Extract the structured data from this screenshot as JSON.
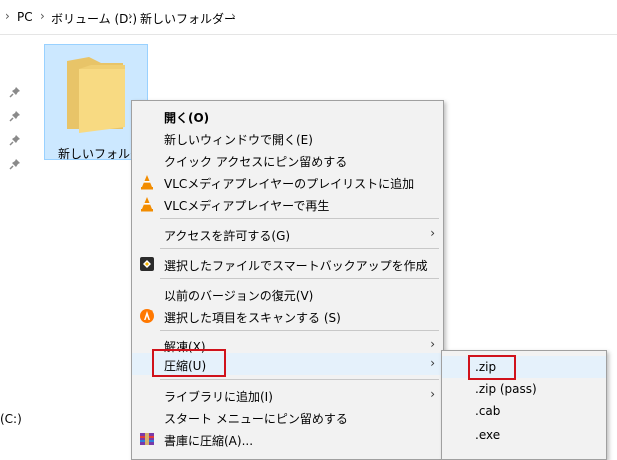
{
  "breadcrumb": {
    "items": [
      "PC",
      "ボリューム (D:)",
      "新しいフォルダー"
    ]
  },
  "navigation": {
    "drive_label": "(C:)"
  },
  "folder": {
    "name": "新しいフォルダー",
    "selected": true
  },
  "context_menu": {
    "items": [
      {
        "label": "開く(O)",
        "bold": true
      },
      {
        "label": "新しいウィンドウで開く(E)"
      },
      {
        "label": "クイック アクセスにピン留めする"
      },
      {
        "label": "VLCメディアプレイヤーのプレイリストに追加",
        "icon": "vlc-cone-icon"
      },
      {
        "label": "VLCメディアプレイヤーで再生",
        "icon": "vlc-cone-icon"
      },
      {
        "label": "アクセスを許可する(G)",
        "submenu": true
      },
      {
        "label": "選択したファイルでスマートバックアップを作成",
        "icon": "backup-app-icon"
      },
      {
        "label": "以前のバージョンの復元(V)"
      },
      {
        "label": "選択した項目をスキャンする (S)",
        "icon": "avast-icon"
      },
      {
        "label": "解凍(X)",
        "submenu": true
      },
      {
        "label": "圧縮(U)",
        "submenu": true,
        "highlighted": true
      },
      {
        "label": "ライブラリに追加(I)",
        "submenu": true
      },
      {
        "label": "スタート メニューにピン留めする"
      },
      {
        "label": "書庫に圧縮(A)...",
        "icon": "archiver-icon"
      }
    ]
  },
  "compress_submenu": {
    "items": [
      ".zip",
      ".zip (pass)",
      ".cab",
      ".exe"
    ]
  },
  "colors": {
    "highlight_box": "#d0121b",
    "menu_background": "#f2f2f2",
    "selection": "#cce8ff"
  }
}
